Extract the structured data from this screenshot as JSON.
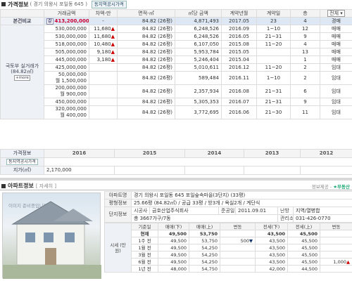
{
  "header": {
    "title": "가격정보",
    "address": "( 경기 의왕시 포일동 645 )",
    "button": "동지역공시가격"
  },
  "price_table": {
    "columns": [
      "거래금액",
      "차액-만",
      "면적-㎡",
      "㎡당 금액",
      "계약년월",
      "계약일",
      "층"
    ],
    "filter_selected": "전체",
    "compare_label": "본건비교",
    "side_label": "국토부 실거래가 (84.82㎡)",
    "more_label": "+more",
    "compare": {
      "tag": "감",
      "price": "413,200,000",
      "diff": "-",
      "area": "84.82 (26평)",
      "per_m2": "4,871,493",
      "ym": "2017.05",
      "day": "23",
      "floor": "4",
      "type": "경매"
    },
    "rows": [
      {
        "price": "530,000,000",
        "diff": "11,680",
        "arrow": "▲",
        "area": "84.82 (26평)",
        "per_m2": "6,248,526",
        "ym": "2016.09",
        "day": "1~10",
        "floor": "12",
        "type": "매매"
      },
      {
        "price": "530,000,000",
        "diff": "11,680",
        "arrow": "▲",
        "area": "84.82 (26평)",
        "per_m2": "6,248,526",
        "ym": "2016.05",
        "day": "21~31",
        "floor": "9",
        "type": "매매"
      },
      {
        "price": "518,000,000",
        "diff": "10,480",
        "arrow": "▲",
        "area": "84.82 (26평)",
        "per_m2": "6,107,050",
        "ym": "2015.08",
        "day": "11~20",
        "floor": "4",
        "type": "매매"
      },
      {
        "price": "505,000,000",
        "diff": "9,180",
        "arrow": "▲",
        "area": "84.82 (26평)",
        "per_m2": "5,953,784",
        "ym": "2015.05",
        "day": "",
        "floor": "13",
        "type": "매매"
      },
      {
        "price": "445,000,000",
        "diff": "3,180",
        "arrow": "▲",
        "area": "84.82 (26평)",
        "per_m2": "5,246,404",
        "ym": "2015.04",
        "day": "",
        "floor": "1",
        "type": "매매"
      },
      {
        "price": "425,000,000",
        "diff": "",
        "arrow": "",
        "area": "84.82 (26평)",
        "per_m2": "5,010,611",
        "ym": "2016.12",
        "day": "11~20",
        "floor": "2",
        "type": "임대"
      },
      {
        "price": "50,000,000",
        "price2": "월 1,500,000",
        "diff": "",
        "arrow": "",
        "area": "84.82 (26평)",
        "per_m2": "589,484",
        "ym": "2016.11",
        "day": "1~10",
        "floor": "2",
        "type": "임대"
      },
      {
        "price": "200,000,000",
        "price2": "월 900,000",
        "diff": "",
        "arrow": "",
        "area": "84.82 (26평)",
        "per_m2": "2,357,934",
        "ym": "2016.08",
        "day": "21~31",
        "floor": "6",
        "type": "임대"
      },
      {
        "price": "450,000,000",
        "diff": "",
        "arrow": "",
        "area": "84.82 (26평)",
        "per_m2": "5,305,353",
        "ym": "2016.07",
        "day": "21~31",
        "floor": "9",
        "type": "임대"
      },
      {
        "price": "320,000,000",
        "price2": "월 400,000",
        "diff": "",
        "arrow": "",
        "area": "84.82 (26평)",
        "per_m2": "3,772,695",
        "ym": "2016.06",
        "day": "21~30",
        "floor": "11",
        "type": "임대"
      }
    ]
  },
  "official_price": {
    "label1": "가격정보",
    "label2": "동지역공시가격",
    "years": [
      "2016",
      "2015",
      "2014",
      "2013",
      "2012"
    ],
    "row_label": "지가(㎡)",
    "values": [
      "2,170,000",
      "",
      "",
      "",
      ""
    ]
  },
  "apt": {
    "title": "아파트정보",
    "detail": "[ 자세히 ]",
    "provider": "정보제공 -",
    "provider_name": "부동산",
    "photo_caption": "이미지 준비중입니다.",
    "apt_name_label": "아파트명",
    "apt_name": "경기 의왕시 포일동 645 포일숲속마을(3단지) (33평)",
    "area_label": "평형정보",
    "area": "25.66평 (84.82㎡) / 공급 33평 / 방3개 / 욕실2개 / 계단식",
    "complex_label": "단지정보",
    "builder_label": "시공사",
    "builder": "금호산업주식회사",
    "completion_label": "준공일",
    "completion": "2011.09.01",
    "heating_label": "난방",
    "heating": "지역/열병합",
    "households": "총 3667가구/7동",
    "mgmt_label": "관리소",
    "mgmt": "031-426-0770"
  },
  "market": {
    "side_label": "시세 (만원)",
    "headers": [
      "기준일",
      "매매(下)",
      "매매(上)",
      "변동",
      "전세(下)",
      "전세(上)",
      "변동"
    ],
    "rows": [
      {
        "date": "현재",
        "s_lo": "49,500",
        "s_hi": "53,750",
        "s_chg": "",
        "s_arrow": "",
        "j_lo": "43,500",
        "j_hi": "45,500",
        "j_chg": "",
        "j_arrow": ""
      },
      {
        "date": "1주 전",
        "s_lo": "49,500",
        "s_hi": "53,750",
        "s_chg": "500",
        "s_arrow": "▼",
        "j_lo": "43,500",
        "j_hi": "45,500",
        "j_chg": "",
        "j_arrow": ""
      },
      {
        "date": "1월 전",
        "s_lo": "49,500",
        "s_hi": "54,250",
        "s_chg": "",
        "s_arrow": "",
        "j_lo": "43,500",
        "j_hi": "45,500",
        "j_chg": "",
        "j_arrow": ""
      },
      {
        "date": "3월 전",
        "s_lo": "49,500",
        "s_hi": "54,250",
        "s_chg": "",
        "s_arrow": "",
        "j_lo": "43,500",
        "j_hi": "45,500",
        "j_chg": "",
        "j_arrow": ""
      },
      {
        "date": "6월 전",
        "s_lo": "49,500",
        "s_hi": "54,250",
        "s_chg": "",
        "s_arrow": "",
        "j_lo": "43,500",
        "j_hi": "45,500",
        "j_chg": "1,000",
        "j_arrow": "▲"
      },
      {
        "date": "1년 전",
        "s_lo": "48,000",
        "s_hi": "54,750",
        "s_chg": "",
        "s_arrow": "",
        "j_lo": "42,000",
        "j_hi": "44,500",
        "j_chg": "",
        "j_arrow": ""
      }
    ]
  }
}
